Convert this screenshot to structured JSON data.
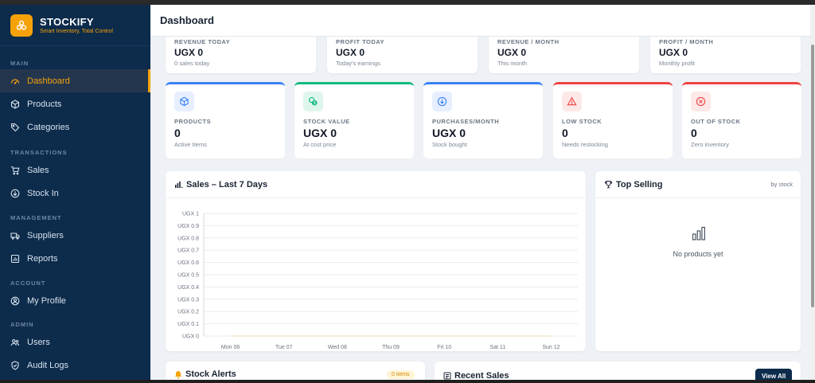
{
  "brand": {
    "name": "STOCKIFY",
    "tagline": "Smart Inventory, Total Control"
  },
  "sidebar": {
    "sections": [
      {
        "label": "MAIN"
      },
      {
        "label": "TRANSACTIONS"
      },
      {
        "label": "MANAGEMENT"
      },
      {
        "label": "ACCOUNT"
      },
      {
        "label": "ADMIN"
      }
    ],
    "items": [
      {
        "label": "Dashboard",
        "icon": "gauge-icon",
        "active": true
      },
      {
        "label": "Products",
        "icon": "box-icon"
      },
      {
        "label": "Categories",
        "icon": "tag-icon"
      },
      {
        "label": "Sales",
        "icon": "cart-icon"
      },
      {
        "label": "Stock In",
        "icon": "arrow-down-circle-icon"
      },
      {
        "label": "Suppliers",
        "icon": "truck-icon"
      },
      {
        "label": "Reports",
        "icon": "report-icon"
      },
      {
        "label": "My Profile",
        "icon": "user-circle-icon"
      },
      {
        "label": "Users",
        "icon": "users-icon"
      },
      {
        "label": "Audit Logs",
        "icon": "shield-icon"
      }
    ]
  },
  "header": {
    "title": "Dashboard"
  },
  "summary": [
    {
      "label": "REVENUE TODAY",
      "value": "UGX 0",
      "sub": "0 sales today"
    },
    {
      "label": "PROFIT TODAY",
      "value": "UGX 0",
      "sub": "Today's earnings"
    },
    {
      "label": "REVENUE / MONTH",
      "value": "UGX 0",
      "sub": "This month"
    },
    {
      "label": "PROFIT / MONTH",
      "value": "UGX 0",
      "sub": "Monthly profit"
    }
  ],
  "stats": [
    {
      "label": "PRODUCTS",
      "value": "0",
      "sub": "Active Items",
      "icon": "cube-icon",
      "color": "#3b82f6"
    },
    {
      "label": "STOCK VALUE",
      "value": "UGX 0",
      "sub": "At cost price",
      "icon": "money-icon",
      "color": "#10b981"
    },
    {
      "label": "PURCHASES/MONTH",
      "value": "UGX 0",
      "sub": "Stock bought",
      "icon": "arrow-down-circle-icon",
      "color": "#3b82f6"
    },
    {
      "label": "LOW STOCK",
      "value": "0",
      "sub": "Needs restocking",
      "icon": "warning-icon",
      "color": "#ef4444"
    },
    {
      "label": "OUT OF STOCK",
      "value": "0",
      "sub": "Zero inventory",
      "icon": "x-circle-icon",
      "color": "#ef4444"
    }
  ],
  "sales_chart": {
    "title": "Sales – Last 7 Days"
  },
  "chart_data": {
    "type": "line",
    "title": "Sales – Last 7 Days",
    "categories": [
      "Mon 06",
      "Tue 07",
      "Wed 08",
      "Thu 09",
      "Fri 10",
      "Sat 11",
      "Sun 12"
    ],
    "y_ticks": [
      "UGX 0",
      "UGX 0.1",
      "UGX 0.2",
      "UGX 0.3",
      "UGX 0.4",
      "UGX 0.5",
      "UGX 0.6",
      "UGX 0.7",
      "UGX 0.8",
      "UGX 0.9",
      "UGX 1"
    ],
    "ylim": [
      0,
      1
    ],
    "series": [
      {
        "values": [
          0,
          0,
          0,
          0,
          0,
          0,
          0
        ]
      }
    ],
    "grid": true
  },
  "top_selling": {
    "title": "Top Selling",
    "note": "by stock",
    "empty": "No products yet"
  },
  "stock_alerts": {
    "title": "Stock Alerts",
    "badge": "0 items"
  },
  "recent_sales": {
    "title": "Recent Sales",
    "button": "View All"
  }
}
